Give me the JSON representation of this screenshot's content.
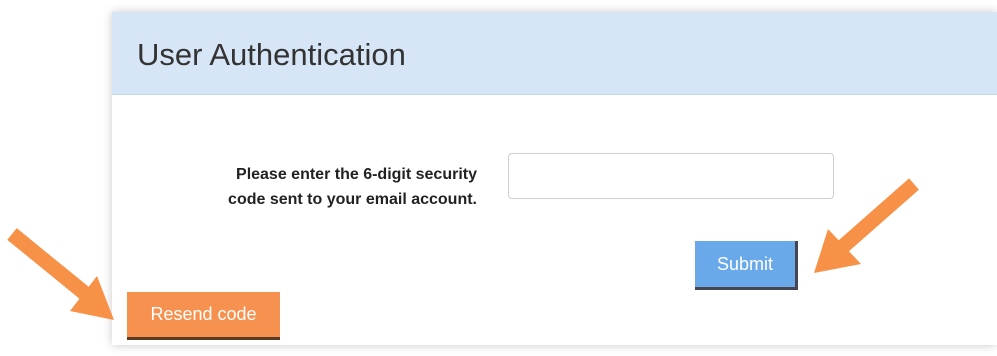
{
  "header": {
    "title": "User Authentication"
  },
  "form": {
    "prompt": "Please enter the 6-digit security\ncode sent to your email account.",
    "code_input_value": "",
    "submit_label": "Submit",
    "resend_label": "Resend code"
  },
  "colors": {
    "header_background": "#d7e6f7",
    "submit_button": "#6aa9e9",
    "resend_button": "#f7914f",
    "annotation_arrow": "#f79147"
  },
  "annotations": {
    "arrow_icon": "arrow-icon"
  }
}
